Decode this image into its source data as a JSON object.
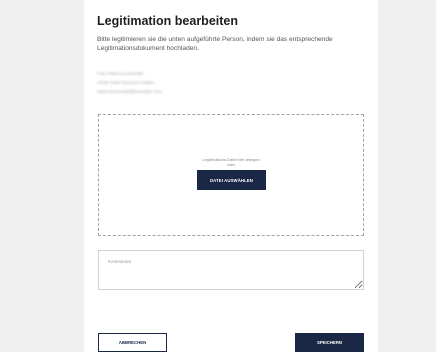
{
  "dialog": {
    "title": "Legitimation bearbeiten",
    "instructions": "Bitte legitimieren sie die unten aufgeführte Person, indem sie das entsprechende Legitimationsdokument hochladen."
  },
  "person": {
    "name": "Frau Rebecca Brendel",
    "company": "AEWI Hotel Services GmbH",
    "email": "rebecca.brendel@example.com"
  },
  "upload": {
    "drop_text": "Legitimations-Datei hier ablegen",
    "or_text": "oder",
    "choose_button": "DATEI AUSWÄHLEN"
  },
  "comment": {
    "placeholder": "Kommentar",
    "value": ""
  },
  "actions": {
    "cancel_label": "ABBRECHEN",
    "save_label": "SPEICHERN"
  },
  "colors": {
    "primary": "#1b2845",
    "background": "#f0f0f0",
    "panel": "#ffffff"
  }
}
